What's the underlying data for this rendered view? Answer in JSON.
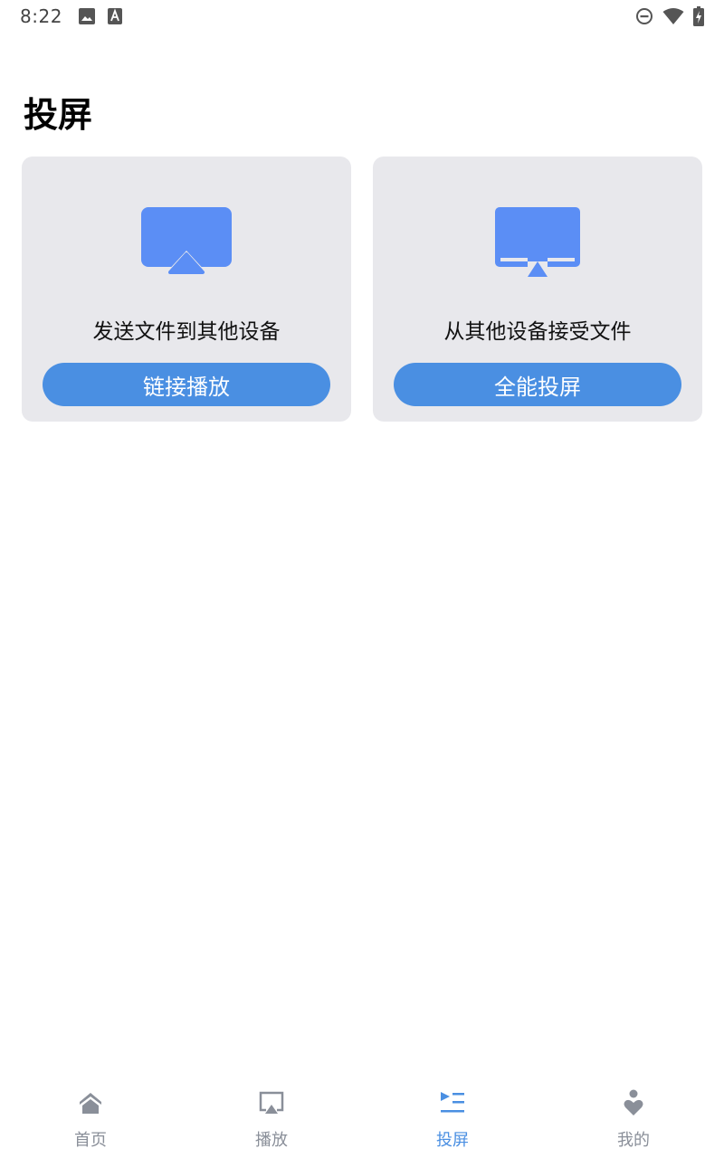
{
  "status_bar": {
    "time": "8:22",
    "left_icons": [
      "image-icon",
      "text-a-icon"
    ],
    "right_icons": [
      "dnd-icon",
      "wifi-icon",
      "battery-charging-icon"
    ]
  },
  "page": {
    "title": "投屏"
  },
  "cards": [
    {
      "icon": "airplay-icon",
      "description": "发送文件到其他设备",
      "button_label": "链接播放"
    },
    {
      "icon": "monitor-receive-icon",
      "description": "从其他设备接受文件",
      "button_label": "全能投屏"
    }
  ],
  "bottom_nav": {
    "items": [
      {
        "label": "首页",
        "icon": "home-icon",
        "active": false
      },
      {
        "label": "播放",
        "icon": "cast-icon",
        "active": false
      },
      {
        "label": "投屏",
        "icon": "play-list-icon",
        "active": true
      },
      {
        "label": "我的",
        "icon": "profile-icon",
        "active": false
      }
    ]
  },
  "colors": {
    "accent": "#4a8fe2",
    "icon_blue": "#5b8ef5",
    "card_bg": "#e8e8ec",
    "nav_inactive": "#8a8f99"
  }
}
